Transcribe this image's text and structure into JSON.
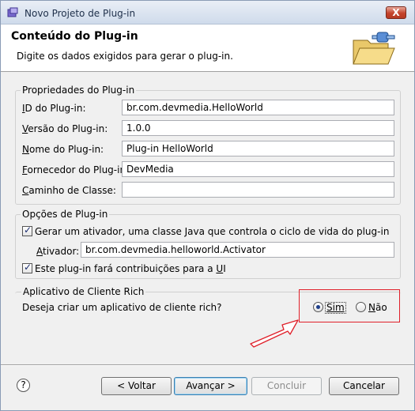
{
  "window": {
    "title": "Novo Projeto de Plug-in",
    "close_label": "X"
  },
  "header": {
    "title": "Conteúdo do Plug-in",
    "description": "Digite os dados exigidos para gerar o plug-in."
  },
  "properties": {
    "legend": "Propriedades do Plug-in",
    "fields": [
      {
        "label_mnemonic": "I",
        "label_rest": "D do Plug-in:",
        "value": "br.com.devmedia.HelloWorld"
      },
      {
        "label_mnemonic": "V",
        "label_rest": "ersão do Plug-in:",
        "value": "1.0.0"
      },
      {
        "label_mnemonic": "N",
        "label_rest": "ome do Plug-in:",
        "value": "Plug-in HelloWorld"
      },
      {
        "label_mnemonic": "F",
        "label_rest": "ornecedor do Plug-in:",
        "value": "DevMedia"
      },
      {
        "label_mnemonic": "C",
        "label_rest": "aminho de Classe:",
        "value": ""
      }
    ]
  },
  "options": {
    "legend": "Opções de Plug-in",
    "generate_activator": {
      "label": "Gerar um ativador, uma classe Java que controla o ciclo de vida do plug-in",
      "checked": true
    },
    "activator": {
      "label_mnemonic": "A",
      "label_rest": "tivador:",
      "value": "br.com.devmedia.helloworld.Activator"
    },
    "ui_contrib": {
      "label_start": "Este plug-in fará contribuições para a ",
      "label_mnemonic": "U",
      "label_end": "I",
      "checked": true
    }
  },
  "rich_client": {
    "legend": "Aplicativo de Cliente Rich",
    "question": "Deseja criar um aplicativo de cliente rich?",
    "yes_label": "Sim",
    "no_label": "Não",
    "selected": "Sim",
    "highlight_color": "#e0202a"
  },
  "footer": {
    "help_label": "?",
    "back_label": "< Voltar",
    "next_label": "Avançar >",
    "finish_label": "Concluir",
    "cancel_label": "Cancelar"
  }
}
